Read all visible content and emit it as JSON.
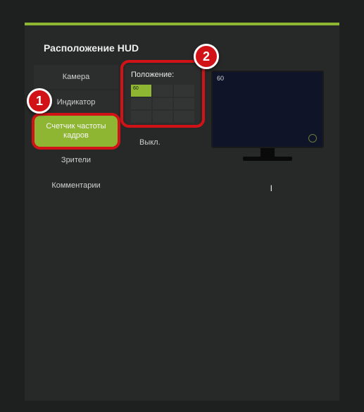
{
  "title": "Расположение HUD",
  "sidebar": {
    "items": [
      {
        "label": "Камера"
      },
      {
        "label": "Индикатор"
      },
      {
        "label": "Счетчик частоты кадров"
      },
      {
        "label": "Зрители"
      },
      {
        "label": "Комментарии"
      }
    ]
  },
  "position": {
    "label": "Положение:",
    "fps_sample": "60",
    "off_label": "Выкл."
  },
  "preview": {
    "fps_value": "60"
  },
  "annotations": {
    "step1": "1",
    "step2": "2"
  }
}
